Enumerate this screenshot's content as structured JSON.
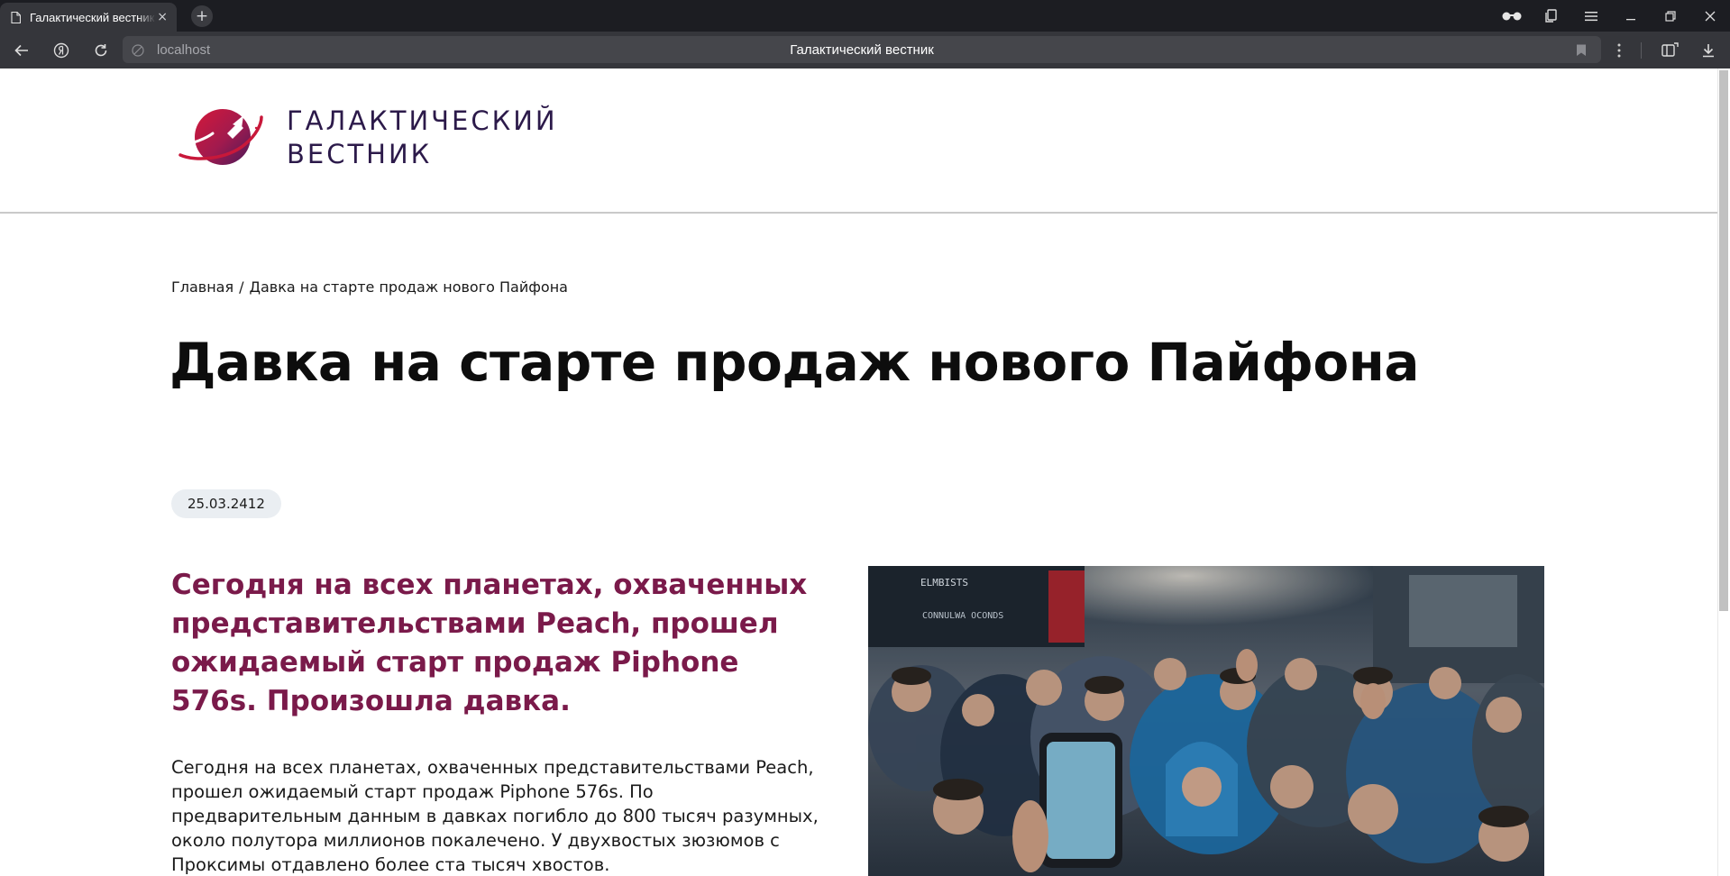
{
  "browser": {
    "tab_title": "Галактический вестник",
    "tab_close": "×",
    "new_tab": "+",
    "url": "localhost",
    "page_title": "Галактический вестник"
  },
  "site": {
    "logo_line1": "ГАЛАКТИЧЕСКИЙ",
    "logo_line2": "ВЕСТНИК"
  },
  "breadcrumb": {
    "home": "Главная",
    "separator": "/",
    "current": "Давка на старте продаж нового Пайфона"
  },
  "article": {
    "title": "Давка на старте продаж нового Пайфона",
    "date": "25.03.2412",
    "lead": "Сегодня на всех планетах, охваченных представительствами Peach, прошел ожидаемый старт продаж Piphone 576s. Произошла давка.",
    "body": "Сегодня на всех планетах, охваченных представительствами Peach, прошел ожидаемый старт продаж Piphone 576s. По предварительным данным в давках погибло до 800 тысяч разумных, около полутора миллионов покалечено. У двухвостых зюзюмов с Проксимы отдавлено более ста тысяч хвостов.",
    "image_sign_1": "ELMBISTS",
    "image_sign_2": "CONNULWA OCONDS"
  },
  "colors": {
    "chrome_dark": "#1c1d22",
    "chrome_toolbar": "#35363b",
    "lead_color": "#7a1a4a",
    "logo_text": "#2c1a4a",
    "date_pill_bg": "#eaeef2"
  }
}
